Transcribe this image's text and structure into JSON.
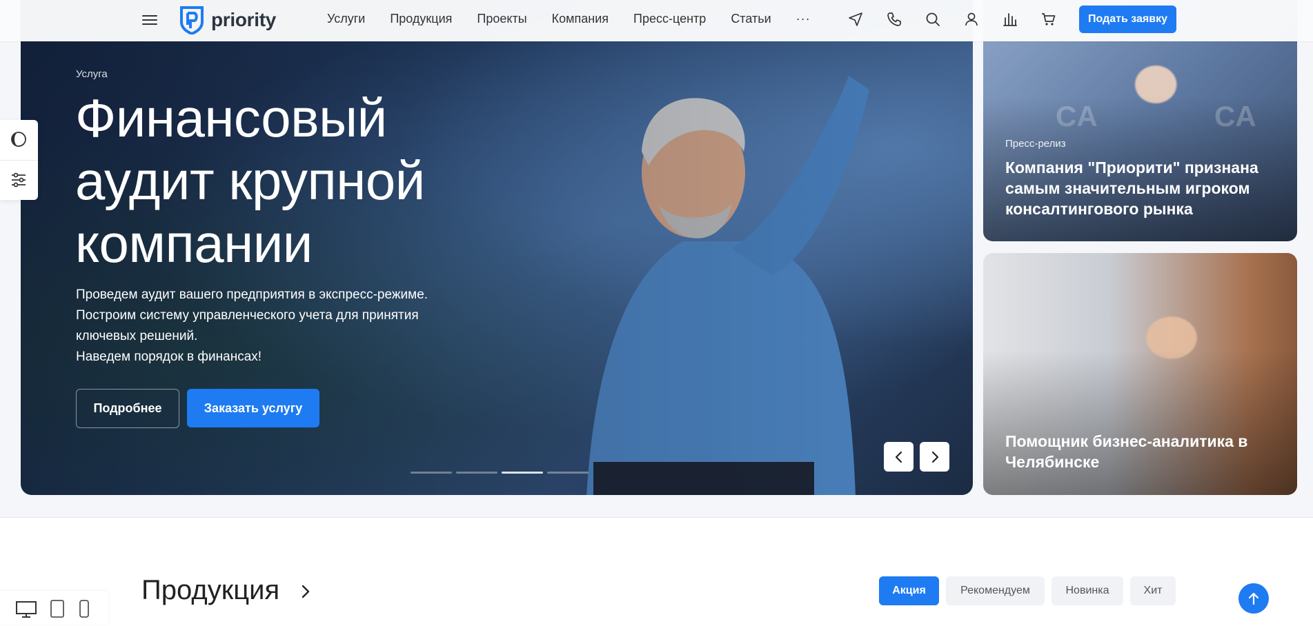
{
  "header": {
    "logo_text": "priority",
    "nav": [
      "Услуги",
      "Продукция",
      "Проекты",
      "Компания",
      "Пресс-центр",
      "Статьи"
    ],
    "more": "···",
    "apply_label": "Подать заявку",
    "icons": [
      "send-icon",
      "phone-icon",
      "search-icon",
      "user-icon",
      "compare-chart-icon",
      "cart-icon"
    ]
  },
  "hero": {
    "tag": "Услуга",
    "title_lines": [
      "Финансовый",
      "аудит крупной",
      "компании"
    ],
    "desc_lines": [
      "Проведем аудит вашего предприятия в экспресс-режиме.",
      "Построим систему управленческого учета для принятия",
      "ключевых решений.",
      "Наведем порядок в финансах!"
    ],
    "more_label": "Подробнее",
    "order_label": "Заказать услугу"
  },
  "cards": [
    {
      "tag": "Пресс-релиз",
      "title": "Компания \"Приорити\" признана самым значительным игроком консалтингового рынка",
      "watermark": "CA"
    },
    {
      "title": "Помощник бизнес-аналитика в Челябинске"
    }
  ],
  "products": {
    "title": "Продукция",
    "filters": [
      "Акция",
      "Рекомендуем",
      "Новинка",
      "Хит"
    ]
  },
  "colors": {
    "accent": "#1e7bf2",
    "annotation_arrow": "#e01b1b"
  }
}
